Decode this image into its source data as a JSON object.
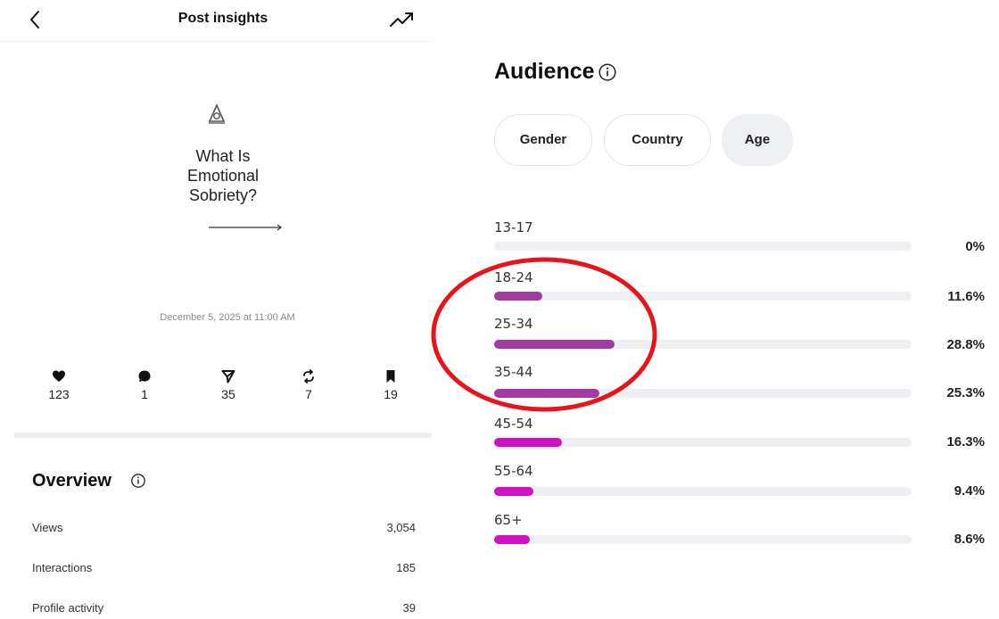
{
  "header": {
    "title": "Post insights"
  },
  "post": {
    "title_lines": [
      "What Is",
      "Emotional",
      "Sobriety?"
    ],
    "date": "December 5, 2025 at 11:00 AM"
  },
  "stats": [
    {
      "icon": "heart-icon",
      "value": "123"
    },
    {
      "icon": "comment-icon",
      "value": "1"
    },
    {
      "icon": "share-icon",
      "value": "35"
    },
    {
      "icon": "repost-icon",
      "value": "7"
    },
    {
      "icon": "bookmark-icon",
      "value": "19"
    }
  ],
  "overview": {
    "title": "Overview",
    "rows": [
      {
        "label": "Views",
        "value": "3,054"
      },
      {
        "label": "Interactions",
        "value": "185"
      },
      {
        "label": "Profile activity",
        "value": "39"
      }
    ]
  },
  "audience": {
    "title": "Audience",
    "tabs": [
      "Gender",
      "Country",
      "Age"
    ],
    "selected_tab": "Age",
    "colors": {
      "bar_dark": "#a23a9f",
      "bar_bright": "#d10fc3",
      "track": "#eef0f3"
    },
    "age_groups": [
      {
        "label": "13-17",
        "percent_label": "0%",
        "value": 0
      },
      {
        "label": "18-24",
        "percent_label": "11.6%",
        "value": 11.6
      },
      {
        "label": "25-34",
        "percent_label": "28.8%",
        "value": 28.8
      },
      {
        "label": "35-44",
        "percent_label": "25.3%",
        "value": 25.3
      },
      {
        "label": "45-54",
        "percent_label": "16.3%",
        "value": 16.3
      },
      {
        "label": "55-64",
        "percent_label": "9.4%",
        "value": 9.4
      },
      {
        "label": "65+",
        "percent_label": "8.6%",
        "value": 8.6
      }
    ]
  },
  "annotation": {
    "shape": "oval",
    "color": "#e8141b",
    "highlights": [
      "18-24",
      "25-34",
      "35-44"
    ]
  }
}
